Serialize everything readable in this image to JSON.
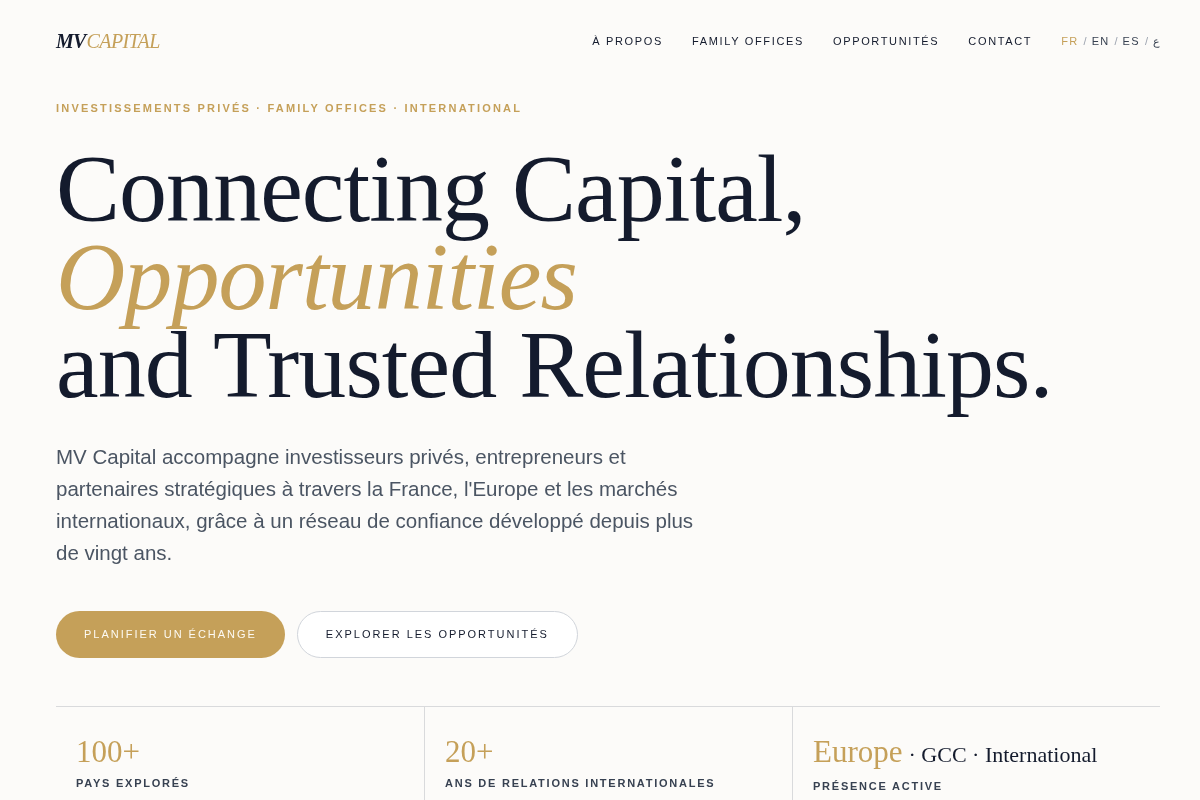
{
  "header": {
    "logo": {
      "mark": "MV",
      "wordmark": "CAPITAL"
    },
    "nav": [
      "À PROPOS",
      "FAMILY OFFICES",
      "OPPORTUNITÉS",
      "CONTACT"
    ],
    "languages": [
      {
        "label": "FR",
        "selected": true
      },
      {
        "label": "EN",
        "selected": false
      },
      {
        "label": "ES",
        "selected": false
      },
      {
        "label": "ع",
        "selected": false
      }
    ],
    "separators": [
      "/",
      "/",
      "/"
    ]
  },
  "hero": {
    "eyebrow": "INVESTISSEMENTS PRIVÉS · FAMILY OFFICES · INTERNATIONAL",
    "headline_lines": [
      {
        "text": "Connecting Capital,",
        "kind": "plain"
      },
      {
        "text": "Opportunities",
        "kind": "accent"
      },
      {
        "text": "and Trusted Relationships.",
        "kind": "plain"
      }
    ],
    "intro": "MV Capital accompagne investisseurs privés, entrepreneurs et partenaires stratégiques à travers la France, l'Europe et les marchés internationaux, grâce à un réseau de confiance développé depuis plus de vingt ans.",
    "buttons": [
      {
        "label": "PLANIFIER UN ÉCHANGE",
        "kind": "primary"
      },
      {
        "label": "EXPLORER LES OPPORTUNITÉS",
        "kind": "secondary"
      }
    ]
  },
  "stats": [
    {
      "value": "100+",
      "label": "PAYS EXPLORÉS"
    },
    {
      "value": "20+",
      "label": "ANS DE RELATIONS INTERNATIONALES"
    },
    {
      "value": "Europe",
      "value_suffix": "· GCC · International",
      "label": "PRÉSENCE ACTIVE"
    }
  ]
}
